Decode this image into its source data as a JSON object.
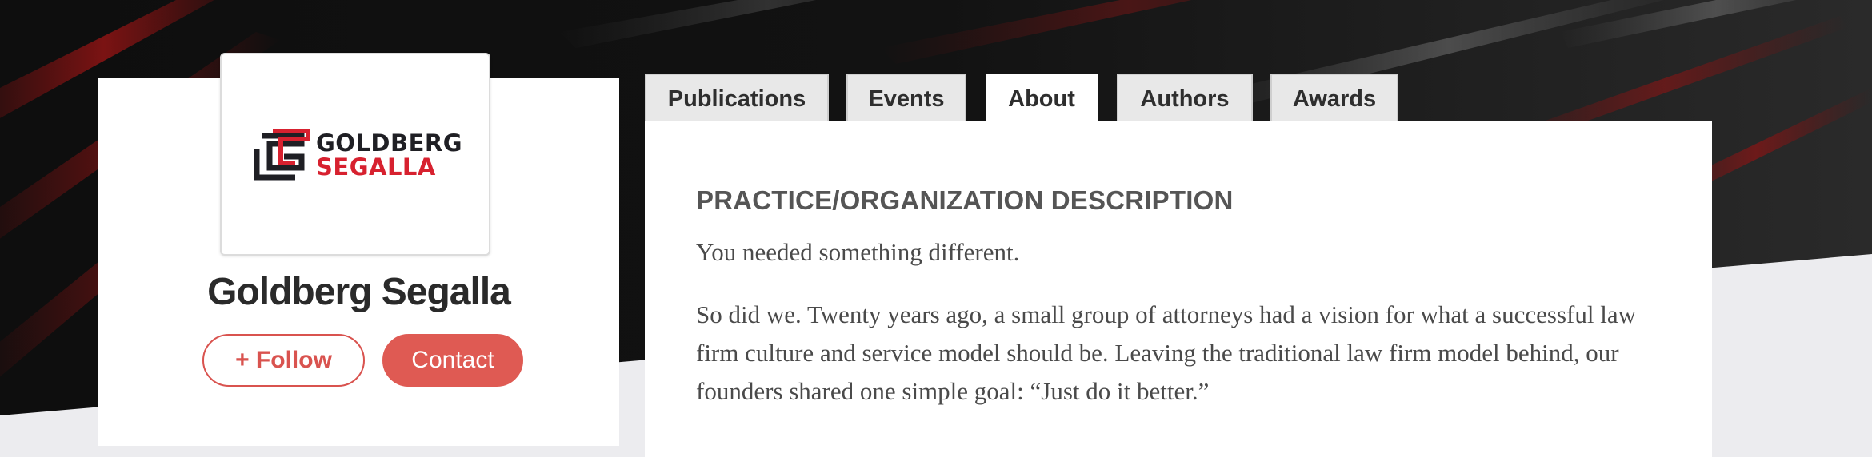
{
  "profile": {
    "logo": {
      "line1": "GOLDBERG",
      "line2": "SEGALLA",
      "mark_icon": "goldberg-segalla-monogram"
    },
    "firm_name": "Goldberg Segalla",
    "follow_label": "+ Follow",
    "contact_label": "Contact"
  },
  "tabs": [
    {
      "label": "Publications",
      "active": false
    },
    {
      "label": "Events",
      "active": false
    },
    {
      "label": "About",
      "active": true
    },
    {
      "label": "Authors",
      "active": false
    },
    {
      "label": "Awards",
      "active": false
    }
  ],
  "about": {
    "heading": "PRACTICE/ORGANIZATION DESCRIPTION",
    "paragraphs": [
      "You needed something different.",
      "So did we. Twenty years ago, a small group of attorneys had a vision for what a successful law firm culture and service model should be. Leaving the traditional law firm model behind, our founders shared one simple goal: “Just do it better.”"
    ]
  },
  "colors": {
    "accent": "#df5a53",
    "brand_red": "#d7212f",
    "brand_dark": "#1f1f24",
    "hero_bg": "#141414"
  }
}
